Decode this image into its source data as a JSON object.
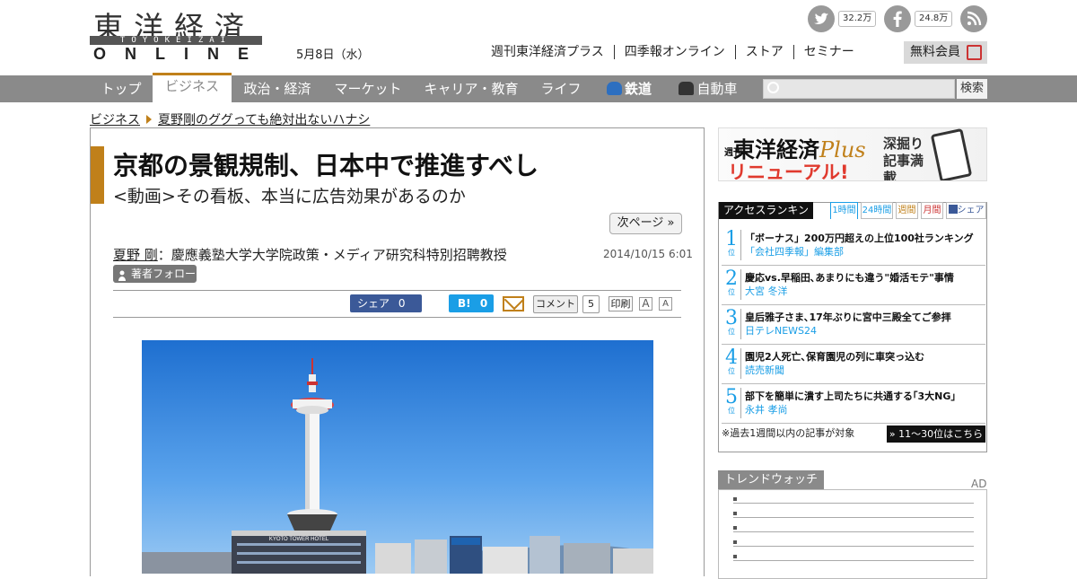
{
  "header": {
    "logo_jp": "東洋経済",
    "logo_mid": "TOYOKEIZAI",
    "logo_en": "ONLINE",
    "date": "5月8日（水）",
    "twitter_count": "32.2万",
    "facebook_count": "24.8万",
    "links": [
      "週刊東洋経済プラス",
      "四季報オンライン",
      "ストア",
      "セミナー"
    ],
    "member_label": "無料会員"
  },
  "nav": {
    "items": [
      "トップ",
      "ビジネス",
      "政治・経済",
      "マーケット",
      "キャリア・教育",
      "ライフ",
      "鉄道",
      "自動車"
    ],
    "active": "ビジネス",
    "search_button": "検索"
  },
  "breadcrumb": [
    "ビジネス",
    "夏野剛のググっても絶対出ないハナシ"
  ],
  "article": {
    "title": "京都の景観規制、日本中で推進すべし",
    "subtitle": "<動画>その看板、本当に広告効果があるのか",
    "next_page": "次ページ »",
    "author_name": "夏野 剛",
    "author_title": "：慶應義塾大学大学院政策・メディア研究科特別招聘教授",
    "timestamp": "2014/10/15 6:01",
    "follow_label": "著者フォロー",
    "share_label": "シェア",
    "share_count": "0",
    "hatena_label": "B!",
    "hatena_count": "0",
    "comment_label": "コメント",
    "comment_count": "5",
    "print_label": "印刷",
    "font_large": "A",
    "font_small": "A",
    "photo_hotel_text": "KYOTO TOWER HOTEL"
  },
  "sidebar": {
    "banner_brand": "東洋経済",
    "banner_plus": "Plus",
    "banner_weekly": "週刊",
    "banner_renewal": "リニューアル!",
    "banner_tagline": "深掘り記事満載",
    "ranking_title": "アクセスランキング",
    "ranking_tabs": [
      "1時間",
      "24時間",
      "週間",
      "月間",
      "シェア"
    ],
    "ranking": [
      {
        "rank": "1",
        "title": "「ボーナス」200万円超えの上位100社ランキング",
        "source": "「会社四季報」編集部"
      },
      {
        "rank": "2",
        "title": "慶応vs.早稲田､あまりにも違う\"婚活モテ\"事情",
        "source": "大宮 冬洋"
      },
      {
        "rank": "3",
        "title": "皇后雅子さま､17年ぶりに宮中三殿全てご参拝",
        "source": "日テレNEWS24"
      },
      {
        "rank": "4",
        "title": "園児2人死亡､保育園児の列に車突っ込む",
        "source": "読売新聞"
      },
      {
        "rank": "5",
        "title": "部下を簡単に潰す上司たちに共通する｢3大NG｣",
        "source": "永井 孝尚"
      }
    ],
    "rank_suffix": "位",
    "ranking_note": "※過去1週間以内の記事が対象",
    "ranking_more": "» 11～30位はこちら",
    "trend_title": "トレンドウォッチ",
    "ad_label": "AD"
  },
  "colors": {
    "accent": "#c0801a",
    "nav_bg": "#8a8a8a",
    "ranking_blue": "#1a9ee6",
    "facebook": "#3b5998"
  }
}
